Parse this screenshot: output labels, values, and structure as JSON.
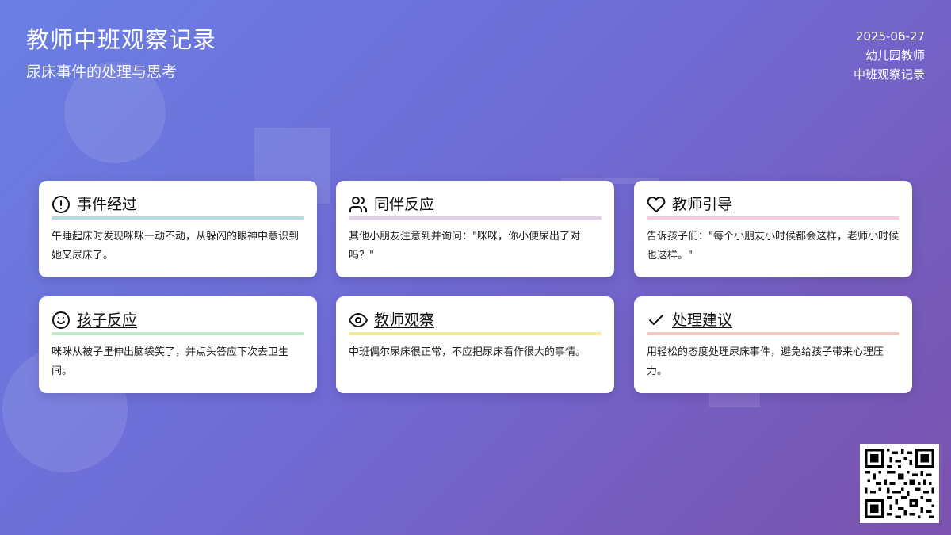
{
  "header": {
    "title": "教师中班观察记录",
    "subtitle": "尿床事件的处理与思考",
    "date": "2025-06-27",
    "author": "幼儿园教师",
    "record_name": "中班观察记录"
  },
  "cards": [
    {
      "icon": "alert-circle-icon",
      "title": "事件经过",
      "bar_color": "#b7d8e6",
      "text": "午睡起床时发现咪咪一动不动，从躲闪的眼神中意识到她又尿床了。"
    },
    {
      "icon": "users-icon",
      "title": "同伴反应",
      "bar_color": "#e2cdee",
      "text": "其他小朋友注意到并询问：\"咪咪，你小便尿出了对吗？\""
    },
    {
      "icon": "heart-icon",
      "title": "教师引导",
      "bar_color": "#f1cde3",
      "text": "告诉孩子们：\"每个小朋友小时候都会这样，老师小时候也这样。\""
    },
    {
      "icon": "smile-icon",
      "title": "孩子反应",
      "bar_color": "#bfeacc",
      "text": "咪咪从被子里伸出脑袋笑了，并点头答应下次去卫生间。"
    },
    {
      "icon": "eye-icon",
      "title": "教师观察",
      "bar_color": "#f7eb9c",
      "text": "中班偶尔尿床很正常，不应把尿床看作很大的事情。"
    },
    {
      "icon": "check-icon",
      "title": "处理建议",
      "bar_color": "#f5c8c4",
      "text": "用轻松的态度处理尿床事件，避免给孩子带来心理压力。"
    }
  ],
  "qr_code": {
    "icon": "qr-code-icon"
  }
}
